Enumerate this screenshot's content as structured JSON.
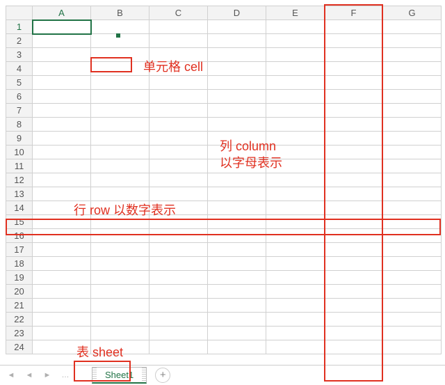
{
  "columns": [
    "A",
    "B",
    "C",
    "D",
    "E",
    "F",
    "G"
  ],
  "rows": [
    "1",
    "2",
    "3",
    "4",
    "5",
    "6",
    "7",
    "8",
    "9",
    "10",
    "11",
    "12",
    "13",
    "14",
    "15",
    "16",
    "17",
    "18",
    "19",
    "20",
    "21",
    "22",
    "23",
    "24"
  ],
  "active_cell": {
    "col": "A",
    "row": "1"
  },
  "sheet_tab": {
    "name": "Sheet1"
  },
  "nav": {
    "first": "◄",
    "prev": "◄",
    "next": "►",
    "last": "…",
    "add": "+"
  },
  "annotations": {
    "cell_label": "单元格 cell",
    "column_label_1": "列 column",
    "column_label_2": "以字母表示",
    "row_label": "行 row 以数字表示",
    "sheet_label": "表 sheet"
  }
}
